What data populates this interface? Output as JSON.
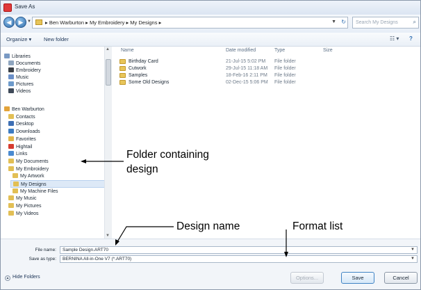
{
  "window": {
    "title": "Save As"
  },
  "address": {
    "crumbs": "▸  Ben Warburton  ▸  My Embroidery  ▸  My Designs  ▸",
    "search_placeholder": "Search My Designs"
  },
  "toolbar": {
    "organize": "Organize ▾",
    "new_folder": "New folder"
  },
  "sidebar": {
    "libraries": [
      {
        "label": "Libraries",
        "color": "#7a9ac4"
      },
      {
        "label": "Documents",
        "color": "#8fa6c0"
      },
      {
        "label": "Embroidery",
        "color": "#3a3f46"
      },
      {
        "label": "Music",
        "color": "#6a8fc8"
      },
      {
        "label": "Pictures",
        "color": "#6d9acb"
      },
      {
        "label": "Videos",
        "color": "#3f4a59"
      }
    ],
    "user": [
      {
        "label": "Ben Warburton",
        "color": "#e3a33a"
      },
      {
        "label": "Contacts",
        "color": "#e2bf55"
      },
      {
        "label": "Desktop",
        "color": "#3e6fb4"
      },
      {
        "label": "Downloads",
        "color": "#3d7cc2"
      },
      {
        "label": "Favorites",
        "color": "#e2b64a"
      },
      {
        "label": "Hightail",
        "color": "#d63b2f"
      },
      {
        "label": "Links",
        "color": "#4a8ad0"
      },
      {
        "label": "My Documents",
        "color": "#e2bf55"
      },
      {
        "label": "My Embroidery",
        "color": "#e2bf55"
      },
      {
        "label": "My Artwork",
        "color": "#e2bf55"
      },
      {
        "label": "My Designs",
        "color": "#e2bf55"
      },
      {
        "label": "My Machine Files",
        "color": "#e2bf55"
      },
      {
        "label": "My Music",
        "color": "#e2bf55"
      },
      {
        "label": "My Pictures",
        "color": "#e2bf55"
      },
      {
        "label": "My Videos",
        "color": "#e2bf55"
      }
    ]
  },
  "columns": {
    "name": "Name",
    "date": "Date modified",
    "type": "Type",
    "size": "Size"
  },
  "files": [
    {
      "name": "Birthday Card",
      "date": "21-Jul-15 5:02 PM",
      "type": "File folder"
    },
    {
      "name": "Cutwork",
      "date": "29-Jul-15 11:18 AM",
      "type": "File folder"
    },
    {
      "name": "Samples",
      "date": "18-Feb-16 2:11 PM",
      "type": "File folder"
    },
    {
      "name": "Some Old Designs",
      "date": "02-Dec-15 5:06 PM",
      "type": "File folder"
    }
  ],
  "fields": {
    "filename_label": "File name:",
    "filename_value": "Sample Design.ART70",
    "savetype_label": "Save as type:",
    "savetype_value": "BERNINA All-in-One V7 (*.ART70)"
  },
  "footer": {
    "hide_folders": "Hide Folders",
    "options": "Options...",
    "save": "Save",
    "cancel": "Cancel"
  },
  "callouts": {
    "folder_line1": "Folder containing",
    "folder_line2": "design",
    "design_name": "Design name",
    "format_list": "Format list"
  }
}
